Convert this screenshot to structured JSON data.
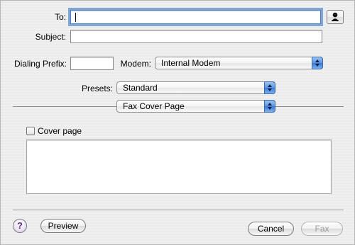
{
  "to": {
    "label": "To:",
    "value": ""
  },
  "subject": {
    "label": "Subject:",
    "value": ""
  },
  "dialing": {
    "label": "Dialing Prefix:",
    "value": ""
  },
  "modem": {
    "label": "Modem:",
    "selected": "Internal Modem"
  },
  "presets": {
    "label": "Presets:",
    "selected": "Standard"
  },
  "section": {
    "selected": "Fax Cover Page"
  },
  "cover": {
    "checkbox_label": "Cover page",
    "checked": false,
    "text": ""
  },
  "buttons": {
    "help": "?",
    "preview": "Preview",
    "cancel": "Cancel",
    "fax": "Fax"
  },
  "icons": {
    "address_book": "person-icon",
    "popup_arrows": "updown-arrows-icon",
    "help": "question-mark-icon"
  },
  "colors": {
    "popup_arrow_blue": "#3a79d6",
    "focus_ring": "#7fa7d6",
    "help_purple": "#5b2a86"
  }
}
